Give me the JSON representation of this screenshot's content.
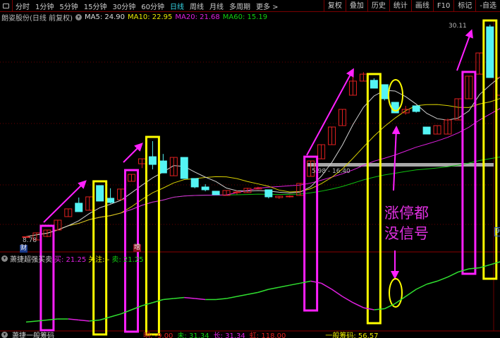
{
  "toolbar": {
    "periods": [
      "分时",
      "1分钟",
      "5分钟",
      "15分钟",
      "30分钟",
      "60分钟",
      "日线",
      "周线",
      "月线",
      "多周期",
      "更多 >"
    ],
    "active": "日线",
    "right_buttons": [
      "复权",
      "叠加",
      "历史",
      "统计",
      "画线",
      "F10",
      "标记",
      "-自选"
    ]
  },
  "info": {
    "stock": "朗姿股份(日线 前复权)",
    "ma5": "MA5: 24.90",
    "ma10": "MA10: 22.95",
    "ma20": "MA20: 21.68",
    "ma60": "MA60: 15.19"
  },
  "chart": {
    "high_label": "30.11",
    "low_label": "8.78",
    "range_label": "5.98 - 16.40",
    "badge_cai": "财",
    "badge_zeng": "增",
    "axis_badge": "9",
    "colors": {
      "up": "#e02020",
      "down": "#54f4f4",
      "ma5": "#d0d0d0",
      "ma10": "#d8d000",
      "ma20": "#e020e0",
      "ma60": "#10c010",
      "box_magenta": "#ff20ff",
      "box_yellow": "#ffff00"
    },
    "candles": [
      [
        9.06,
        9.1,
        9.0,
        9.06
      ],
      [
        8.78,
        9.48,
        8.78,
        9.48
      ],
      [
        9.13,
        9.76,
        9.05,
        9.76
      ],
      [
        9.76,
        10.74,
        9.76,
        10.74
      ],
      [
        11.09,
        11.86,
        11.09,
        11.86
      ],
      [
        12.42,
        11.58,
        12.98,
        11.58
      ],
      [
        11.72,
        13.05,
        11.72,
        13.05
      ],
      [
        14.17,
        12.63,
        14.17,
        12.63
      ],
      [
        12.91,
        12.49,
        13.9,
        12.4
      ],
      [
        12.77,
        13.82,
        12.77,
        13.82
      ],
      [
        14.59,
        15.28,
        14.59,
        15.28
      ],
      [
        16.33,
        16.82,
        16.82,
        15.9
      ],
      [
        17.03,
        16.26,
        18.57,
        15.77
      ],
      [
        16.61,
        15.42,
        17.3,
        15.42
      ],
      [
        15.14,
        16.96,
        15.14,
        16.96
      ],
      [
        16.96,
        14.87,
        16.96,
        14.87
      ],
      [
        14.87,
        14.03,
        14.87,
        13.9
      ],
      [
        14.03,
        13.75,
        14.3,
        13.6
      ],
      [
        13.61,
        13.26,
        13.61,
        13.26
      ],
      [
        13.19,
        13.68,
        13.19,
        13.68
      ],
      [
        13.5,
        13.54,
        13.7,
        13.3
      ],
      [
        13.47,
        13.89,
        13.47,
        13.95
      ],
      [
        13.82,
        13.96,
        13.82,
        14.05
      ],
      [
        13.75,
        13.05,
        13.75,
        12.9
      ],
      [
        12.98,
        13.12,
        12.85,
        13.12
      ],
      [
        13.05,
        13.12,
        12.98,
        13.2
      ],
      [
        13.19,
        14.38,
        13.19,
        14.38
      ],
      [
        15.08,
        16.61,
        15.08,
        16.61
      ],
      [
        16.82,
        18.22,
        16.82,
        18.22
      ],
      [
        18.22,
        19.97,
        18.22,
        19.97
      ],
      [
        20.11,
        21.72,
        20.11,
        21.72
      ],
      [
        23.12,
        24.52,
        23.12,
        25.01
      ],
      [
        24.52,
        25.21,
        24.52,
        25.4
      ],
      [
        24.6,
        23.82,
        24.8,
        23.82
      ],
      [
        24.17,
        22.77,
        24.17,
        22.6
      ],
      [
        22.42,
        21.37,
        22.42,
        21.37
      ],
      [
        21.37,
        21.72,
        21.2,
        22.07
      ],
      [
        22.07,
        21.51,
        22.07,
        21.4
      ],
      [
        19.97,
        19.27,
        19.97,
        19.27
      ],
      [
        19.27,
        20.11,
        19.27,
        20.11
      ],
      [
        19.27,
        20.67,
        19.27,
        20.8
      ],
      [
        20.67,
        22.77,
        20.67,
        22.77
      ],
      [
        22.77,
        25.01,
        22.77,
        25.01
      ],
      [
        25.21,
        27.31,
        25.21,
        27.31
      ],
      [
        29.9,
        24.87,
        30.11,
        24.87
      ],
      [
        23.12,
        24.87,
        23.12,
        25.6
      ]
    ]
  },
  "annotation": {
    "text_line1": "涨停都",
    "text_line2": "没信号",
    "boxes": [
      {
        "index": 2,
        "color": "magenta"
      },
      {
        "index": 7,
        "color": "yellow"
      },
      {
        "index": 10,
        "color": "magenta"
      },
      {
        "index": 12,
        "color": "yellow"
      },
      {
        "index": 27,
        "color": "magenta"
      },
      {
        "index": 33,
        "color": "yellow"
      },
      {
        "index": 42,
        "color": "magenta"
      },
      {
        "index": 44,
        "color": "yellow"
      }
    ]
  },
  "indicator": {
    "name": "萧捷超强买卖",
    "buy": "买: 21.25",
    "watch": "关注: -",
    "sell": "卖: 21.25",
    "line": [
      8,
      9,
      10,
      11,
      11,
      10,
      9,
      10,
      13,
      16,
      20,
      24,
      27,
      30,
      31,
      32,
      31,
      30,
      30,
      31,
      33,
      35,
      37,
      40,
      42,
      44,
      46,
      48,
      46,
      40,
      33,
      27,
      22,
      20,
      21,
      26,
      33,
      40,
      45,
      48,
      52,
      57,
      60,
      61,
      64,
      67
    ]
  },
  "bottom": {
    "name": "萧捷一般筹码",
    "ming": "明: -9.00",
    "wei": "未: 31.34",
    "chang": "长: 31.34",
    "hong": "虹: 118.00",
    "chips": "一般筹码: 56.57"
  }
}
